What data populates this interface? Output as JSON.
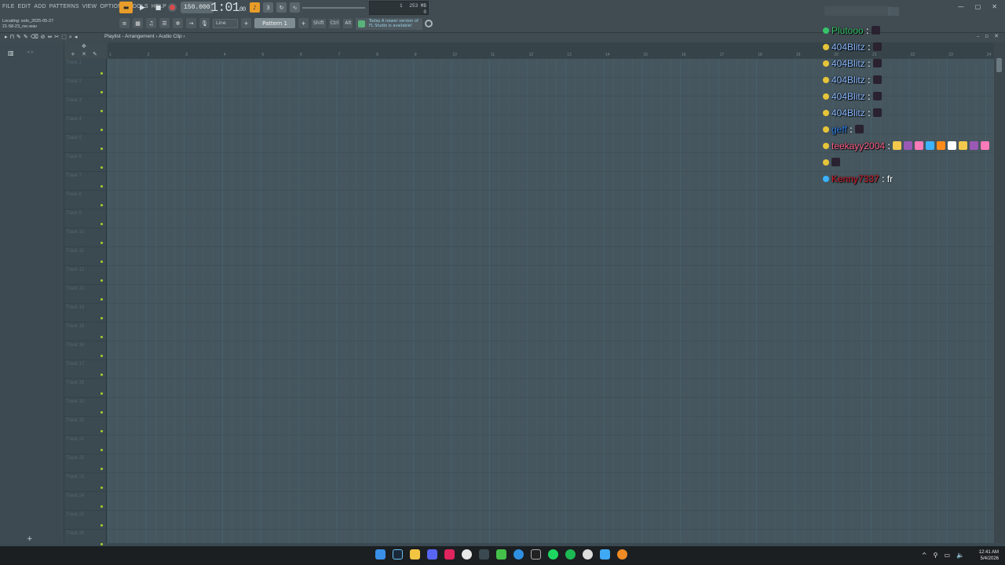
{
  "menu": [
    "FILE",
    "EDIT",
    "ADD",
    "PATTERNS",
    "VIEW",
    "OPTIONS",
    "TOOLS",
    "HELP"
  ],
  "transport": {
    "tempo": "150.000",
    "time": "1:01",
    "time_small": "00"
  },
  "meter": {
    "a": "1",
    "b": "253 MB",
    "c": "0"
  },
  "file_info": {
    "line1": "Locating: solo_2025-05-27",
    "line2": "21-58-23_rec.wav"
  },
  "toolbar2": {
    "snap": "Line",
    "pattern": "Pattern 1",
    "shift": "Shift",
    "ctrl": "Ctrl",
    "alt": "Alt"
  },
  "news": {
    "line1": "Today  A newer version of",
    "line2": "FL Studio is available!"
  },
  "breadcrumb": "Playlist - Arrangement › Audio Clip ›",
  "ruler": [
    "1",
    "2",
    "3",
    "4",
    "5",
    "6",
    "7",
    "8",
    "9",
    "10",
    "11",
    "12",
    "13",
    "14",
    "15",
    "16",
    "17",
    "18",
    "19",
    "20",
    "21",
    "22",
    "23",
    "24"
  ],
  "tracks": [
    "Track 1",
    "Track 2",
    "Track 3",
    "Track 4",
    "Track 5",
    "Track 6",
    "Track 7",
    "Track 8",
    "Track 9",
    "Track 10",
    "Track 11",
    "Track 12",
    "Track 13",
    "Track 14",
    "Track 15",
    "Track 16",
    "Track 17",
    "Track 18",
    "Track 19",
    "Track 20",
    "Track 21",
    "Track 22",
    "Track 23",
    "Track 24",
    "Track 25",
    "Track 26"
  ],
  "chat": [
    {
      "name": "Plutooo",
      "color": "#35c46a",
      "msg": ""
    },
    {
      "name": "404Blitz",
      "color": "#8ab8ff",
      "msg": ""
    },
    {
      "name": "404Blitz",
      "color": "#8ab8ff",
      "msg": ""
    },
    {
      "name": "404Blitz",
      "color": "#8ab8ff",
      "msg": ""
    },
    {
      "name": "404Blitz",
      "color": "#8ab8ff",
      "msg": ""
    },
    {
      "name": "404Blitz",
      "color": "#8ab8ff",
      "msg": ""
    },
    {
      "name": "geff",
      "color": "#2f7ee8",
      "msg": ""
    },
    {
      "name": "teekayy2004",
      "color": "#ff5e87",
      "msg": ""
    },
    {
      "name": "",
      "color": "#ff4444",
      "msg": ""
    },
    {
      "name": "Kenny7337",
      "color": "#d11a2a",
      "msg": "fr"
    }
  ],
  "clock": {
    "time": "12:41 AM",
    "date": "5/4/2026"
  },
  "colors": {
    "accent": "#e89d2a",
    "grid": "#45565e",
    "track_dot": "#a7d22f",
    "taskbar": "#1c1f22"
  }
}
